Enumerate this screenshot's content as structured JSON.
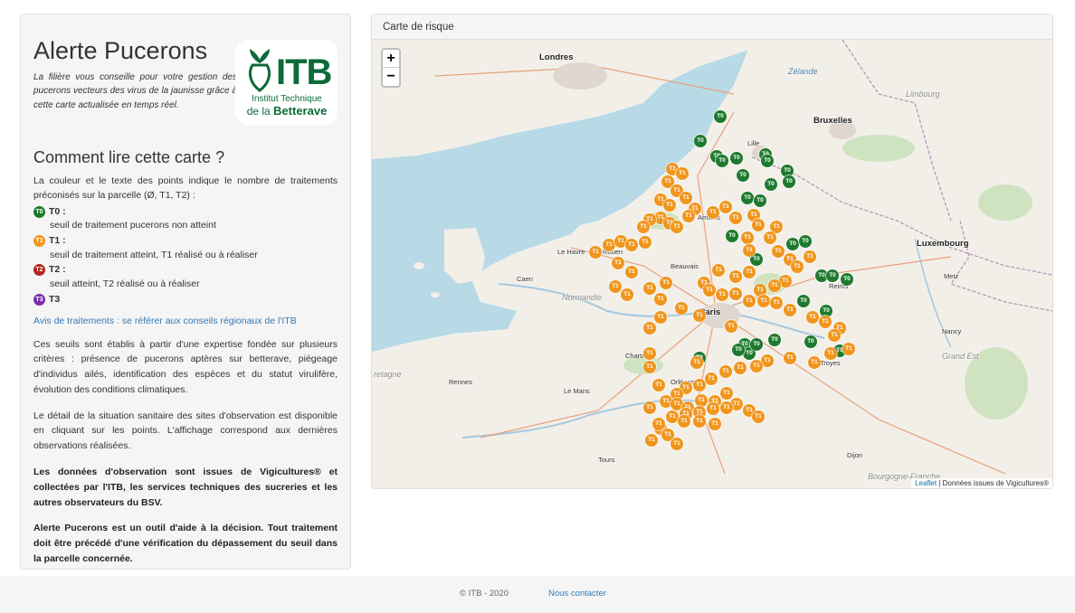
{
  "sidebar": {
    "title": "Alerte Pucerons",
    "intro": "La filière vous conseille pour votre gestion des pucerons vecteurs des virus de la jaunisse grâce à cette carte actualisée en temps réel.",
    "logo": {
      "initials": "ITB",
      "line1": "Institut Technique",
      "line2_prefix": "de la ",
      "line2_bold": "Betterave",
      "colors": {
        "green": "#0b6b39"
      }
    },
    "howto_title": "Comment lire cette carte ?",
    "howto_text": "La couleur et le texte des points indique le nombre de traitements préconisés sur la parcelle (Ø, T1, T2) :",
    "legend": [
      {
        "code": "T0",
        "label": "T0 :",
        "desc": "seuil de traitement pucerons non atteint",
        "color": "#1e7a2e"
      },
      {
        "code": "T1",
        "label": "T1 :",
        "desc": "seuil de traitement atteint, T1 réalisé ou à réaliser",
        "color": "#f0961e"
      },
      {
        "code": "T2",
        "label": "T2 :",
        "desc": "seuil atteint, T2 réalisé ou à réaliser",
        "color": "#b3261e"
      },
      {
        "code": "T3",
        "label": "T3",
        "desc": "",
        "color": "#7b2fa8"
      }
    ],
    "advice_link": "Avis de traitements : se référer aux conseils régionaux de l'ITB",
    "paragraph1": "Ces seuils sont établis à partir d'une expertise fondée sur plusieurs critères : présence de pucerons aptères sur betterave, piégeage d'individus ailés, identification des espèces et du statut virulifère, évolution des conditions climatiques.",
    "paragraph2": "Le détail de la situation sanitaire des sites d'observation est disponible en cliquant sur les points. L'affichage correspond aux dernières observations réalisées.",
    "bold1": "Les données d'observation sont issues de Vigicultures® et collectées par l'ITB, les services techniques des sucreries et les autres observateurs du BSV.",
    "bold2": "Alerte Pucerons est un outil d'aide à la décision. Tout traitement doit être précédé d'une vérification du dépassement du seuil dans la parcelle concernée."
  },
  "map": {
    "panel_title": "Carte de risque",
    "zoom_in": "+",
    "zoom_out": "−",
    "attribution_link": "Leaflet",
    "attribution_text": " | Données issues de Vigicultures®",
    "marker_colors": {
      "T0": "#1e7a2e",
      "T1": "#f0961e"
    },
    "labels": {
      "londres": "Londres",
      "bruxelles": "Bruxelles",
      "paris": "Paris",
      "luxembourg": "Luxembourg",
      "lille": "Lille",
      "rouen": "Rouen",
      "amiens": "Amiens",
      "reims": "Reims",
      "caen": "Caen",
      "le_havre": "Le Havre",
      "le_mans": "Le Mans",
      "orleans": "Orléans",
      "tours": "Tours",
      "nancy": "Nancy",
      "rennes": "Rennes",
      "troyes": "Troyes",
      "dijon": "Dijon",
      "metz": "Metz",
      "beauvais": "Beauvais",
      "chartres": "Chartres",
      "normandie": "Normandie",
      "bourgogne": "Bourgogne-Franche",
      "grand_est": "Grand Est",
      "bretagne": "retagne",
      "zelande": "Zélande",
      "limbourg": "Limbourg"
    }
  },
  "footer": {
    "copyright": "© ITB - 2020",
    "contact": "Nous contacter"
  }
}
